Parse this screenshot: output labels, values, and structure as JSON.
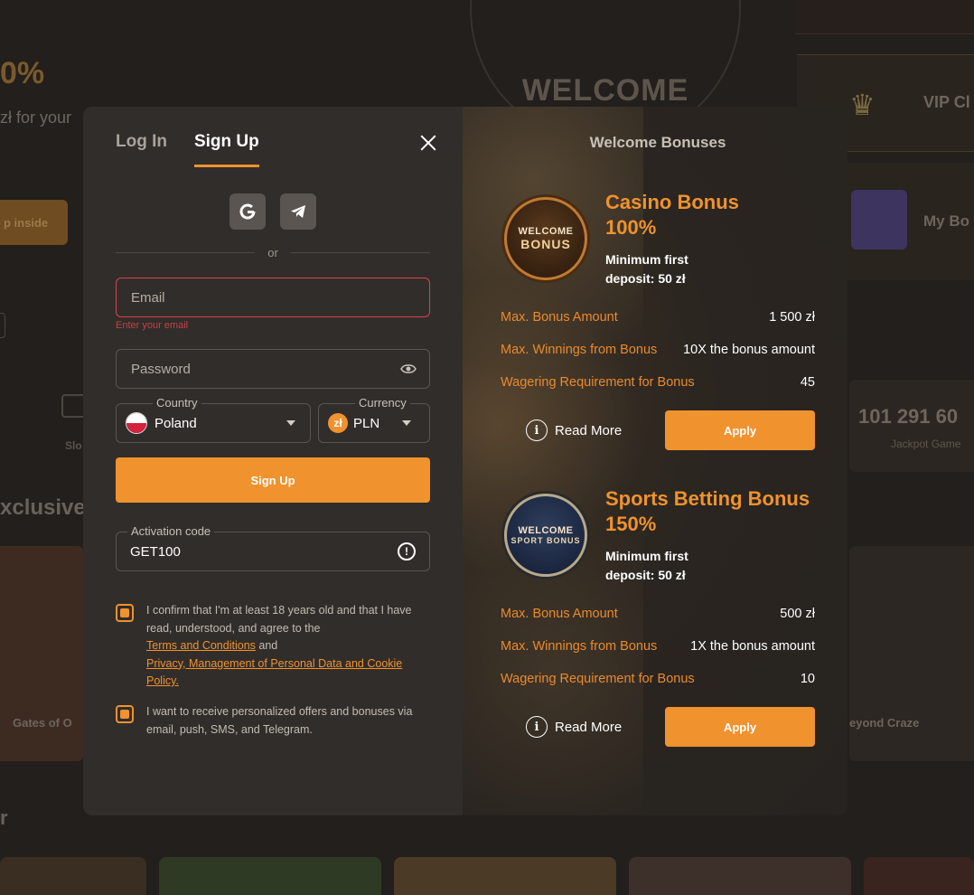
{
  "background": {
    "promo_percent": "0%",
    "promo_sub": "zł for your",
    "promo_button": "p inside",
    "welcome_text": "WELCOME",
    "vip_label": "VIP Cl",
    "my_bonus_label": "My Bo",
    "jackpot_amount": "101 291 60",
    "jackpot_label": "Jackpot Game",
    "exclusive_heading": "xclusive",
    "slots_label": "Slo",
    "card_left_title": "Gates of O",
    "card_right_title": "eyond Craze",
    "bottom_heading": "r"
  },
  "auth": {
    "tabs": [
      {
        "label": "Log In"
      },
      {
        "label": "Sign Up"
      }
    ],
    "social": {
      "google_icon": "google-icon",
      "telegram_icon": "telegram-icon"
    },
    "or_label": "or",
    "email": {
      "placeholder": "Email",
      "error": "Enter your email"
    },
    "password": {
      "placeholder": "Password"
    },
    "country": {
      "legend": "Country",
      "value": "Poland"
    },
    "currency": {
      "legend": "Currency",
      "symbol": "zł",
      "value": "PLN"
    },
    "signup_button": "Sign Up",
    "activation": {
      "legend": "Activation code",
      "value": "GET100"
    },
    "consent1": {
      "text": "I confirm that I'm at least 18 years old and that I have read, understood, and agree to the",
      "link1": "Terms and Conditions",
      "and": "and",
      "link2": "Privacy, Management of Personal Data and Cookie Policy."
    },
    "consent2": {
      "text": "I want to receive personalized offers and bonuses via email, push, SMS, and Telegram."
    }
  },
  "bonuses": {
    "title": "Welcome Bonuses",
    "items": [
      {
        "coin_line1": "WELCOME",
        "coin_line2": "BONUS",
        "name_line1": "Casino Bonus",
        "name_line2": "100%",
        "min_line1": "Minimum first",
        "min_line2": "deposit: 50 zł",
        "rows": [
          {
            "k": "Max. Bonus Amount",
            "v": "1 500 zł"
          },
          {
            "k": "Max. Winnings from Bonus",
            "v": "10X the bonus amount"
          },
          {
            "k": "Wagering Requirement for Bonus",
            "v": "45"
          }
        ],
        "read_more": "Read More",
        "apply": "Apply"
      },
      {
        "coin_line1": "WELCOME",
        "coin_line2": "SPORT BONUS",
        "name_line1": "Sports Betting Bonus",
        "name_line2": "150%",
        "min_line1": "Minimum first",
        "min_line2": "deposit: 50 zł",
        "rows": [
          {
            "k": "Max. Bonus Amount",
            "v": "500 zł"
          },
          {
            "k": "Max. Winnings from Bonus",
            "v": "1X the bonus amount"
          },
          {
            "k": "Wagering Requirement for Bonus",
            "v": "10"
          }
        ],
        "read_more": "Read More",
        "apply": "Apply"
      }
    ]
  },
  "colors": {
    "accent": "#f0922e",
    "error": "#d8434b",
    "modal_bg": "#312d2a"
  }
}
